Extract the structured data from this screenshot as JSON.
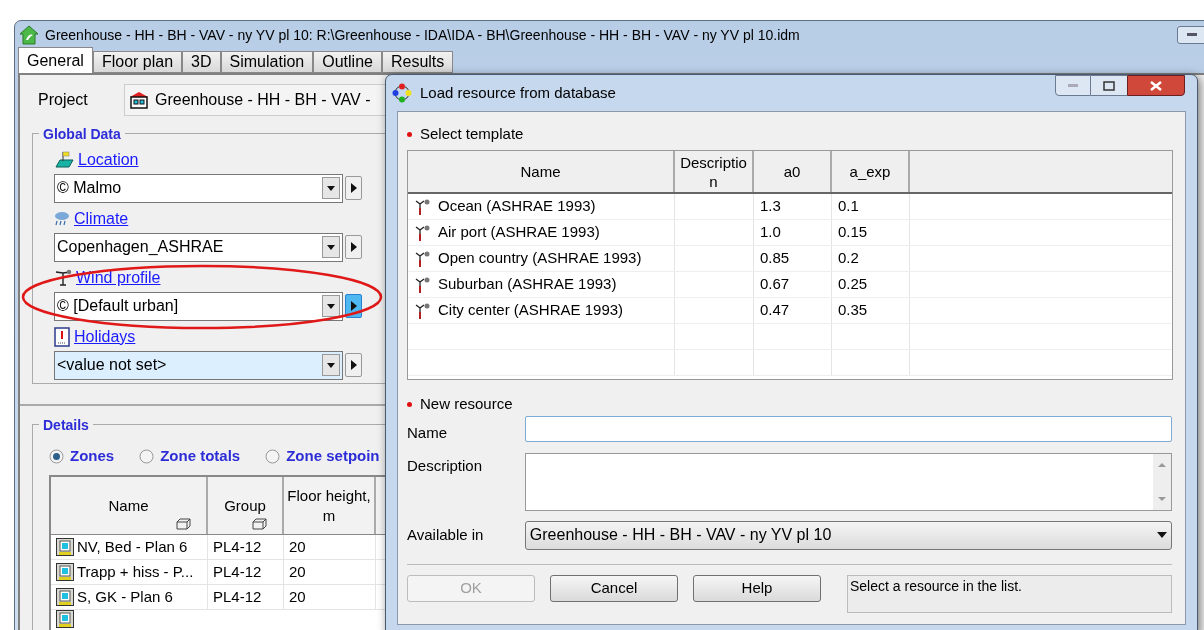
{
  "window": {
    "title": "Greenhouse - HH - BH - VAV - ny YV pl 10: R:\\Greenhouse - IDA\\IDA - BH\\Greenhouse - HH - BH - VAV - ny YV pl 10.idm"
  },
  "tabs": [
    {
      "label": "General",
      "selected": true
    },
    {
      "label": "Floor plan",
      "selected": false
    },
    {
      "label": "3D",
      "selected": false
    },
    {
      "label": "Simulation",
      "selected": false
    },
    {
      "label": "Outline",
      "selected": false
    },
    {
      "label": "Results",
      "selected": false
    }
  ],
  "project": {
    "label": "Project",
    "value": "Greenhouse - HH - BH - VAV -"
  },
  "global_data": {
    "title": "Global Data",
    "fields": [
      {
        "kind": "location",
        "label": "Location",
        "value": "© Malmo",
        "unset": false,
        "focused": false,
        "circled": false
      },
      {
        "kind": "climate",
        "label": "Climate",
        "value": "Copenhagen_ASHRAE",
        "unset": false,
        "focused": false,
        "circled": false
      },
      {
        "kind": "wind",
        "label": "Wind profile",
        "value": "© [Default urban]",
        "unset": false,
        "focused": true,
        "circled": true
      },
      {
        "kind": "holidays",
        "label": "Holidays",
        "value": "<value not set>",
        "unset": true,
        "focused": false,
        "circled": false
      }
    ]
  },
  "details": {
    "title": "Details",
    "radios": [
      {
        "label": "Zones",
        "selected": true
      },
      {
        "label": "Zone totals",
        "selected": false
      },
      {
        "label": "Zone setpoin",
        "selected": false
      }
    ],
    "table": {
      "columns": [
        {
          "label": "Name",
          "sortable": true
        },
        {
          "label": "Group",
          "sortable": true
        },
        {
          "label": "Floor height, m",
          "sortable": false
        }
      ],
      "rows": [
        [
          "NV, Bed - Plan 6",
          "PL4-12",
          "20"
        ],
        [
          "Trapp + hiss - P...",
          "PL4-12",
          "20"
        ],
        [
          "S, GK - Plan 6",
          "PL4-12",
          "20"
        ]
      ]
    }
  },
  "dialog": {
    "title": "Load resource from database",
    "template": {
      "title": "Select template",
      "columns": [
        "Name",
        "Description",
        "a0",
        "a_exp"
      ],
      "rows": [
        [
          "Ocean (ASHRAE 1993)",
          "",
          "1.3",
          "0.1"
        ],
        [
          "Air port (ASHRAE 1993)",
          "",
          "1.0",
          "0.15"
        ],
        [
          "Open country (ASHRAE 1993)",
          "",
          "0.85",
          "0.2"
        ],
        [
          "Suburban (ASHRAE 1993)",
          "",
          "0.67",
          "0.25"
        ],
        [
          "City center (ASHRAE 1993)",
          "",
          "0.47",
          "0.35"
        ]
      ]
    },
    "new_resource": {
      "title": "New resource",
      "name_label": "Name",
      "description_label": "Description",
      "available_label": "Available in",
      "available_value": "Greenhouse - HH - BH - VAV - ny YV pl 10"
    },
    "buttons": [
      {
        "label": "OK",
        "disabled": true
      },
      {
        "label": "Cancel",
        "disabled": false
      },
      {
        "label": "Help",
        "disabled": false
      }
    ],
    "status": "Select a resource in the list."
  }
}
